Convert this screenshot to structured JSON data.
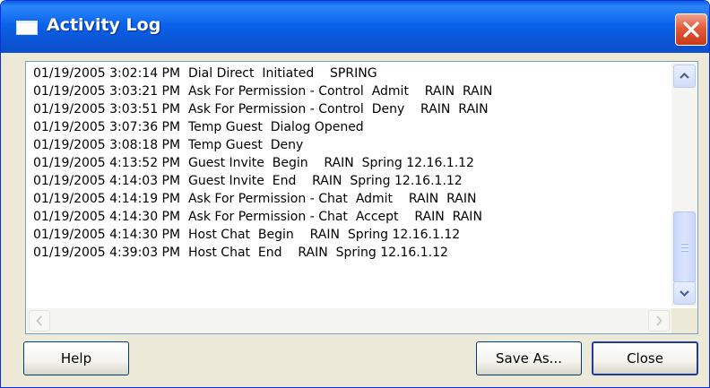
{
  "window": {
    "title": "Activity Log",
    "close_glyph": "close-x-icon"
  },
  "log": {
    "lines": [
      "01/19/2005 3:02:14 PM  Dial Direct  Initiated    SPRING",
      "01/19/2005 3:03:21 PM  Ask For Permission - Control  Admit    RAIN  RAIN",
      "01/19/2005 3:03:51 PM  Ask For Permission - Control  Deny    RAIN  RAIN",
      "01/19/2005 3:07:36 PM  Temp Guest  Dialog Opened",
      "01/19/2005 3:08:18 PM  Temp Guest  Deny",
      "01/19/2005 4:13:52 PM  Guest Invite  Begin    RAIN  Spring 12.16.1.12",
      "01/19/2005 4:14:03 PM  Guest Invite  End    RAIN  Spring 12.16.1.12",
      "01/19/2005 4:14:19 PM  Ask For Permission - Chat  Admit    RAIN  RAIN",
      "01/19/2005 4:14:30 PM  Ask For Permission - Chat  Accept    RAIN  RAIN",
      "01/19/2005 4:14:30 PM  Host Chat  Begin    RAIN  Spring 12.16.1.12",
      "01/19/2005 4:39:03 PM  Host Chat  End    RAIN  Spring 12.16.1.12"
    ],
    "vertical_scroll_position": 0.75
  },
  "buttons": {
    "help": "Help",
    "save_as": "Save As...",
    "close": "Close"
  },
  "icons": {
    "title": "window-icon",
    "scroll_up": "chevron-up-icon",
    "scroll_down": "chevron-down-icon",
    "scroll_left": "chevron-left-icon",
    "scroll_right": "chevron-right-icon"
  },
  "colors": {
    "titlebar": "#0b63ec",
    "close_button": "#e35a3a",
    "dialog_background": "#ece9d8",
    "default_button_border": "#1e3c9c"
  }
}
